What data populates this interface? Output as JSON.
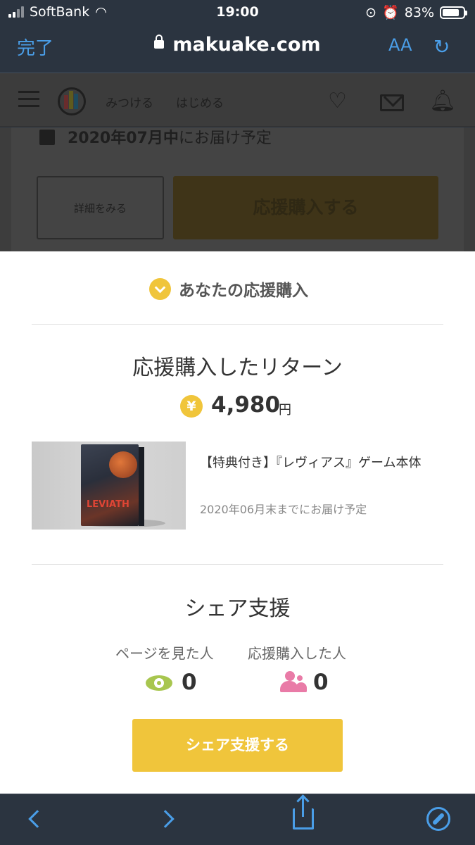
{
  "status_bar": {
    "carrier": "SoftBank",
    "time": "19:00",
    "battery": "83%",
    "battery_fill": 0.83
  },
  "browser": {
    "done_label": "完了",
    "url": "makuake.com",
    "text_size_label": "AA"
  },
  "site_header": {
    "nav": [
      "みつける",
      "はじめる"
    ]
  },
  "background_page": {
    "delivery_date": "2020年07月中",
    "delivery_suffix": "にお届け予定",
    "detail_button": "詳細をみる",
    "support_button": "応援購入する"
  },
  "sheet": {
    "title": "あなたの応援購入",
    "return_heading": "応援購入したリターン",
    "yen_symbol": "¥",
    "price": "4,980",
    "price_unit": "円",
    "item": {
      "title": "【特典付き】『レヴィアス』ゲーム本体",
      "delivery": "2020年06月末までにお届け予定",
      "image_box_title": "LEVIATH"
    },
    "share_heading": "シェア支援",
    "stats": [
      {
        "label": "ページを見た人",
        "value": "0",
        "icon": "eye-icon"
      },
      {
        "label": "応援購入した人",
        "value": "0",
        "icon": "people-icon"
      }
    ],
    "share_button": "シェア支援する"
  },
  "colors": {
    "accent": "#f0c53b",
    "safari_blue": "#4a9ee8",
    "eye_green": "#a8c64f",
    "people_pink": "#e97ba7"
  }
}
